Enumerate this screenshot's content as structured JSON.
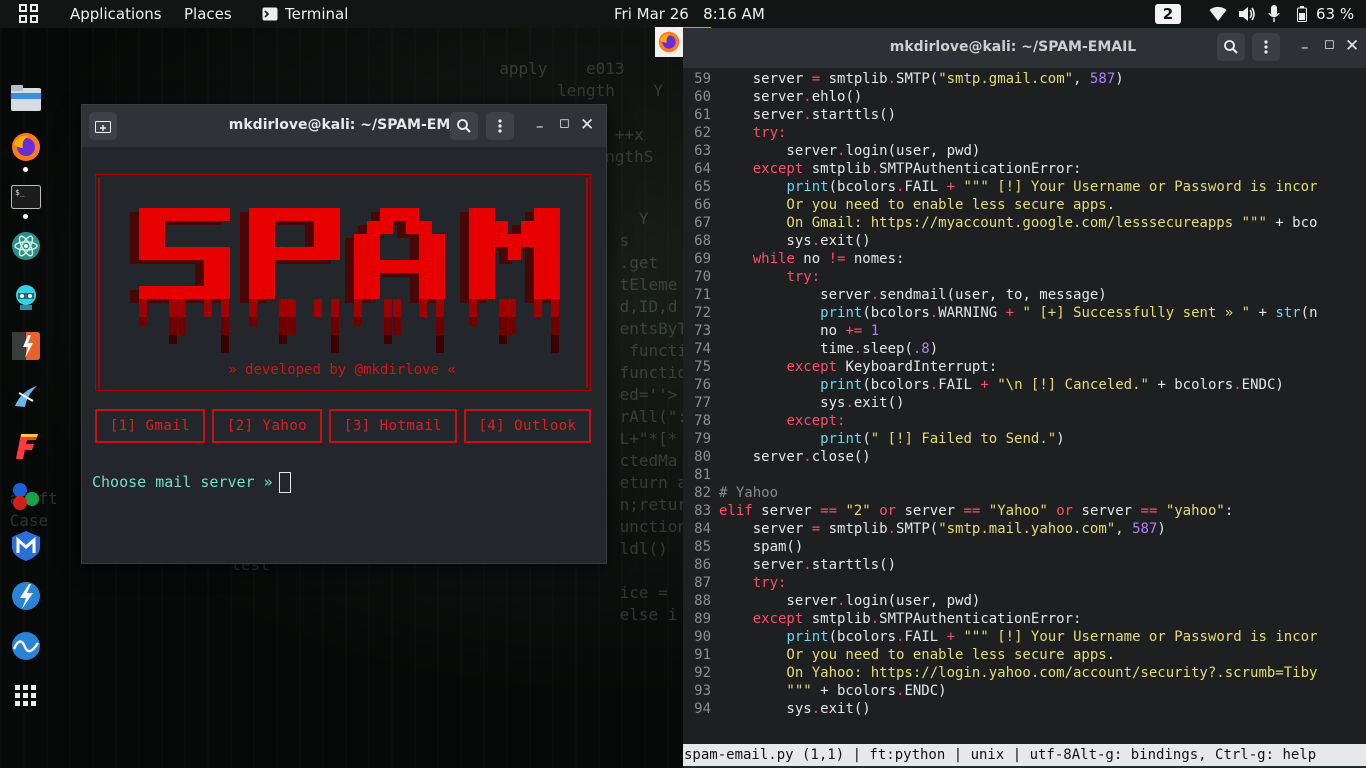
{
  "topbar": {
    "applications": "Applications",
    "places": "Places",
    "terminal": "Terminal",
    "clock": "Fri Mar 26   8:16 AM",
    "workspace": "2",
    "battery": "63 %"
  },
  "dock": {
    "items": [
      "file-manager",
      "firefox",
      "terminal",
      "atom",
      "maltego",
      "burpsuite",
      "kali-tool",
      "flameshot",
      "color-picker",
      "metasploit",
      "zenmap",
      "wireshark",
      "show-apps"
    ]
  },
  "term1": {
    "title": "mkdirlove@kali: ~/SPAM-EMAIL",
    "banner_text": "SPAM",
    "developed_by": "» developed by @mkdirlove «",
    "options": [
      "[1] Gmail",
      "[2] Yahoo",
      "[3] Hotmail",
      "[4] Outlook"
    ],
    "prompt": "Choose mail server » "
  },
  "term2": {
    "title": "mkdirlove@kali: ~/SPAM-EMAIL",
    "statusline": "spam-email.py (1,1) | ft:python | unix | utf-8Alt-g: bindings, Ctrl-g: help",
    "lines": [
      {
        "n": "59",
        "segs": [
          [
            "    server ",
            "t"
          ],
          [
            "=",
            "r"
          ],
          [
            " smtplib",
            "t"
          ],
          [
            ".",
            "r"
          ],
          [
            "SMTP(",
            "t"
          ],
          [
            "\"smtp.gmail.com\"",
            "y"
          ],
          [
            ", ",
            "t"
          ],
          [
            "587",
            "p"
          ],
          [
            ")",
            "t"
          ]
        ]
      },
      {
        "n": "60",
        "segs": [
          [
            "    server",
            "t"
          ],
          [
            ".",
            "r"
          ],
          [
            "ehlo()",
            "t"
          ]
        ]
      },
      {
        "n": "61",
        "segs": [
          [
            "    server",
            "t"
          ],
          [
            ".",
            "r"
          ],
          [
            "starttls()",
            "t"
          ]
        ]
      },
      {
        "n": "62",
        "segs": [
          [
            "    ",
            "t"
          ],
          [
            "try:",
            "r"
          ]
        ]
      },
      {
        "n": "63",
        "segs": [
          [
            "        server",
            "t"
          ],
          [
            ".",
            "r"
          ],
          [
            "login(user, pwd)",
            "t"
          ]
        ]
      },
      {
        "n": "64",
        "segs": [
          [
            "    ",
            "t"
          ],
          [
            "except",
            "r"
          ],
          [
            " smtplib",
            "t"
          ],
          [
            ".",
            "r"
          ],
          [
            "SMTPAuthenticationError:",
            "t"
          ]
        ]
      },
      {
        "n": "65",
        "segs": [
          [
            "        ",
            "t"
          ],
          [
            "print",
            "c"
          ],
          [
            "(bcolors",
            "t"
          ],
          [
            ".",
            "r"
          ],
          [
            "FAIL ",
            "t"
          ],
          [
            "+",
            "r"
          ],
          [
            " ",
            "t"
          ],
          [
            "\"\"\" [!] Your Username or Password is incor",
            "y"
          ]
        ]
      },
      {
        "n": "66",
        "segs": [
          [
            "        Or you need to enable less secure apps.",
            "y"
          ]
        ]
      },
      {
        "n": "67",
        "segs": [
          [
            "        On Gmail: https://myaccount.google.com/lesssecureapps \"\"\"",
            "y"
          ],
          [
            " + bco",
            "t"
          ]
        ]
      },
      {
        "n": "68",
        "segs": [
          [
            "        sys",
            "t"
          ],
          [
            ".",
            "r"
          ],
          [
            "exit()",
            "t"
          ]
        ]
      },
      {
        "n": "69",
        "segs": [
          [
            "    ",
            "t"
          ],
          [
            "while",
            "r"
          ],
          [
            " no ",
            "t"
          ],
          [
            "!=",
            "r"
          ],
          [
            " nomes:",
            "t"
          ]
        ]
      },
      {
        "n": "70",
        "segs": [
          [
            "        ",
            "t"
          ],
          [
            "try:",
            "r"
          ]
        ]
      },
      {
        "n": "71",
        "segs": [
          [
            "            server",
            "t"
          ],
          [
            ".",
            "r"
          ],
          [
            "sendmail(user, to, message)",
            "t"
          ]
        ]
      },
      {
        "n": "72",
        "segs": [
          [
            "            ",
            "t"
          ],
          [
            "print",
            "c"
          ],
          [
            "(bcolors",
            "t"
          ],
          [
            ".",
            "r"
          ],
          [
            "WARNING ",
            "t"
          ],
          [
            "+",
            "r"
          ],
          [
            " ",
            "t"
          ],
          [
            "\" [+] Successfully sent » \"",
            "y"
          ],
          [
            " + ",
            "t"
          ],
          [
            "str",
            "c"
          ],
          [
            "(n",
            "t"
          ]
        ]
      },
      {
        "n": "73",
        "segs": [
          [
            "            no ",
            "t"
          ],
          [
            "+=",
            "r"
          ],
          [
            " ",
            "t"
          ],
          [
            "1",
            "p"
          ]
        ]
      },
      {
        "n": "74",
        "segs": [
          [
            "            time",
            "t"
          ],
          [
            ".",
            "r"
          ],
          [
            "sleep(",
            "t"
          ],
          [
            ".8",
            "p"
          ],
          [
            ")",
            "t"
          ]
        ]
      },
      {
        "n": "75",
        "segs": [
          [
            "        ",
            "t"
          ],
          [
            "except",
            "r"
          ],
          [
            " KeyboardInterrupt:",
            "t"
          ]
        ]
      },
      {
        "n": "76",
        "segs": [
          [
            "            ",
            "t"
          ],
          [
            "print",
            "c"
          ],
          [
            "(bcolors",
            "t"
          ],
          [
            ".",
            "r"
          ],
          [
            "FAIL ",
            "t"
          ],
          [
            "+",
            "r"
          ],
          [
            " ",
            "t"
          ],
          [
            "\"\\n [!] Canceled.\"",
            "y"
          ],
          [
            " + bcolors",
            "t"
          ],
          [
            ".",
            "r"
          ],
          [
            "ENDC)",
            "t"
          ]
        ]
      },
      {
        "n": "77",
        "segs": [
          [
            "            sys",
            "t"
          ],
          [
            ".",
            "r"
          ],
          [
            "exit()",
            "t"
          ]
        ]
      },
      {
        "n": "78",
        "segs": [
          [
            "        ",
            "t"
          ],
          [
            "except:",
            "r"
          ]
        ]
      },
      {
        "n": "79",
        "segs": [
          [
            "            ",
            "t"
          ],
          [
            "print",
            "c"
          ],
          [
            "(",
            "t"
          ],
          [
            "\" [!] Failed to Send.\"",
            "y"
          ],
          [
            ")",
            "t"
          ]
        ]
      },
      {
        "n": "80",
        "segs": [
          [
            "    server",
            "t"
          ],
          [
            ".",
            "r"
          ],
          [
            "close()",
            "t"
          ]
        ]
      },
      {
        "n": "81",
        "segs": []
      },
      {
        "n": "82",
        "segs": [
          [
            "# Yahoo",
            "g"
          ]
        ]
      },
      {
        "n": "83",
        "segs": [
          [
            "elif",
            "r"
          ],
          [
            " server ",
            "t"
          ],
          [
            "==",
            "r"
          ],
          [
            " ",
            "t"
          ],
          [
            "\"2\"",
            "y"
          ],
          [
            " ",
            "t"
          ],
          [
            "or",
            "r"
          ],
          [
            " server ",
            "t"
          ],
          [
            "==",
            "r"
          ],
          [
            " ",
            "t"
          ],
          [
            "\"Yahoo\"",
            "y"
          ],
          [
            " ",
            "t"
          ],
          [
            "or",
            "r"
          ],
          [
            " server ",
            "t"
          ],
          [
            "==",
            "r"
          ],
          [
            " ",
            "t"
          ],
          [
            "\"yahoo\"",
            "y"
          ],
          [
            ":",
            "t"
          ]
        ]
      },
      {
        "n": "84",
        "segs": [
          [
            "    server ",
            "t"
          ],
          [
            "=",
            "r"
          ],
          [
            " smtplib",
            "t"
          ],
          [
            ".",
            "r"
          ],
          [
            "SMTP(",
            "t"
          ],
          [
            "\"smtp.mail.yahoo.com\"",
            "y"
          ],
          [
            ", ",
            "t"
          ],
          [
            "587",
            "p"
          ],
          [
            ")",
            "t"
          ]
        ]
      },
      {
        "n": "85",
        "segs": [
          [
            "    spam()",
            "t"
          ]
        ]
      },
      {
        "n": "86",
        "segs": [
          [
            "    server",
            "t"
          ],
          [
            ".",
            "r"
          ],
          [
            "starttls()",
            "t"
          ]
        ]
      },
      {
        "n": "87",
        "segs": [
          [
            "    ",
            "t"
          ],
          [
            "try:",
            "r"
          ]
        ]
      },
      {
        "n": "88",
        "segs": [
          [
            "        server",
            "t"
          ],
          [
            ".",
            "r"
          ],
          [
            "login(user, pwd)",
            "t"
          ]
        ]
      },
      {
        "n": "89",
        "segs": [
          [
            "    ",
            "t"
          ],
          [
            "except",
            "r"
          ],
          [
            " smtplib",
            "t"
          ],
          [
            ".",
            "r"
          ],
          [
            "SMTPAuthenticationError:",
            "t"
          ]
        ]
      },
      {
        "n": "90",
        "segs": [
          [
            "        ",
            "t"
          ],
          [
            "print",
            "c"
          ],
          [
            "(bcolors",
            "t"
          ],
          [
            ".",
            "r"
          ],
          [
            "FAIL ",
            "t"
          ],
          [
            "+",
            "r"
          ],
          [
            " ",
            "t"
          ],
          [
            "\"\"\" [!] Your Username or Password is incor",
            "y"
          ]
        ]
      },
      {
        "n": "91",
        "segs": [
          [
            "        Or you need to enable less secure apps.",
            "y"
          ]
        ]
      },
      {
        "n": "92",
        "segs": [
          [
            "        On Yahoo: https://login.yahoo.com/account/security?.scrumb=Tiby",
            "y"
          ]
        ]
      },
      {
        "n": "93",
        "segs": [
          [
            "        \"\"\"",
            "y"
          ],
          [
            " + bcolors",
            "t"
          ],
          [
            ".",
            "r"
          ],
          [
            "ENDC)",
            "t"
          ]
        ]
      },
      {
        "n": "94",
        "segs": [
          [
            "        sys",
            "t"
          ],
          [
            ".",
            "r"
          ],
          [
            "exit()",
            "t"
          ]
        ]
      }
    ]
  },
  "colors": {
    "t": "#e6e6e6",
    "r": "#ff4d6a",
    "y": "#e6db74",
    "c": "#66d9ef",
    "p": "#ae81ff",
    "g": "#8a8a8a",
    "spam_red": "#e60000",
    "menu_red": "#c81010",
    "prompt": "#6fe0d0"
  }
}
